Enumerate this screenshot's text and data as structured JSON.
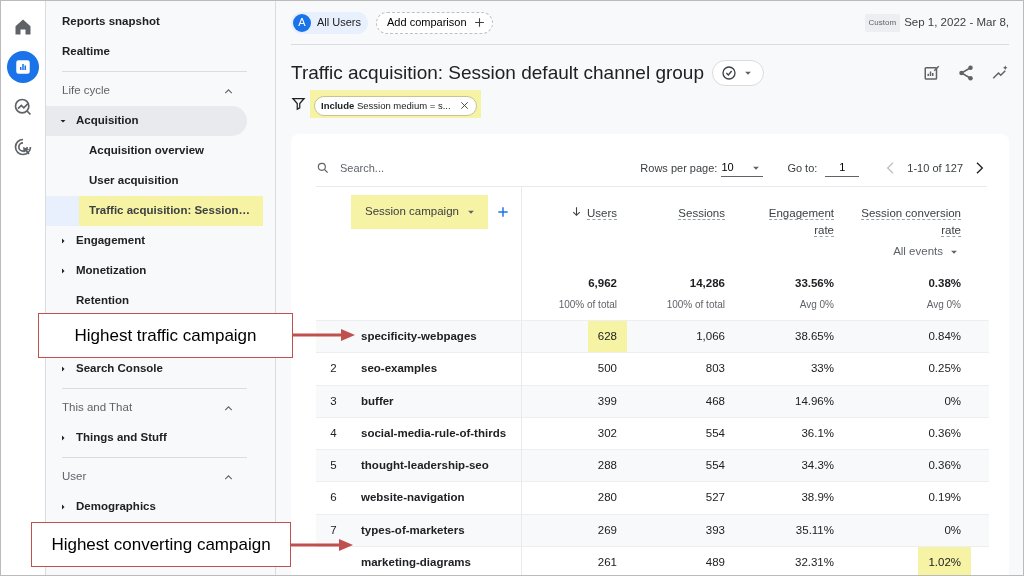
{
  "rail": [
    {
      "selected": false
    },
    {
      "selected": true
    },
    {
      "selected": false
    },
    {
      "selected": false
    }
  ],
  "sidebar": {
    "links": [
      {
        "label": "Reports snapshot"
      },
      {
        "label": "Realtime"
      }
    ],
    "sections": [
      {
        "title": "Life cycle",
        "expanded": true,
        "items": [
          {
            "label": "Acquisition",
            "expanded": true,
            "children": [
              {
                "label": "Acquisition overview",
                "selected": false,
                "highlighted": false
              },
              {
                "label": "User acquisition",
                "selected": false,
                "highlighted": false
              },
              {
                "label": "Traffic acquisition: Session…",
                "selected": true,
                "highlighted": true
              }
            ]
          },
          {
            "label": "Engagement",
            "expanded": false
          },
          {
            "label": "Monetization",
            "expanded": false
          },
          {
            "label": "Retention"
          },
          {
            "label": "Search Console",
            "expanded": false
          }
        ]
      },
      {
        "title": "This and That",
        "expanded": true,
        "items": [
          {
            "label": "Things and Stuff",
            "expanded": false
          }
        ]
      },
      {
        "title": "User",
        "expanded": true,
        "items": [
          {
            "label": "Demographics",
            "expanded": false
          }
        ]
      }
    ]
  },
  "topbar": {
    "segment": {
      "avatar": "A",
      "label": "All Users"
    },
    "add_comparison": "Add comparison",
    "date_badge": "Custom",
    "date_range": "Sep 1, 2022 - Mar 8,"
  },
  "report": {
    "title": "Traffic acquisition: Session default channel group",
    "filter": {
      "text": "**Include** Session medium = s...",
      "highlighted": true
    }
  },
  "table": {
    "search": {
      "placeholder": "Search..."
    },
    "rows_per_page_label": "Rows per page:",
    "rows_per_page": "10",
    "goto_label": "Go to:",
    "goto": "1",
    "range": "1-10 of 127",
    "dimension": {
      "label": "Session campaign",
      "highlighted": true
    },
    "columns": [
      {
        "label": "Users",
        "sorted": true
      },
      {
        "label": "Sessions",
        "sorted": false
      },
      {
        "label": "Engagement rate",
        "sorted": false
      },
      {
        "label": "Session conversion rate",
        "sorted": false,
        "dropdown": "All events"
      }
    ],
    "totals": [
      {
        "value": "6,962",
        "note": "100% of total"
      },
      {
        "value": "14,286",
        "note": "100% of total"
      },
      {
        "value": "33.56%",
        "note": "Avg 0%"
      },
      {
        "value": "0.38%",
        "note": "Avg 0%"
      }
    ],
    "rows": [
      {
        "campaign": "specificity-webpages",
        "cells": [
          {
            "text": "628",
            "highlighted": true
          },
          {
            "text": "1,066",
            "highlighted": false
          },
          {
            "text": "38.65%",
            "highlighted": false
          },
          {
            "text": "0.84%",
            "highlighted": false
          }
        ]
      },
      {
        "rank": "2",
        "campaign": "seo-examples",
        "cells": [
          {
            "text": "500",
            "highlighted": false
          },
          {
            "text": "803",
            "highlighted": false
          },
          {
            "text": "33%",
            "highlighted": false
          },
          {
            "text": "0.25%",
            "highlighted": false
          }
        ]
      },
      {
        "rank": "3",
        "campaign": "buffer",
        "cells": [
          {
            "text": "399",
            "highlighted": false
          },
          {
            "text": "468",
            "highlighted": false
          },
          {
            "text": "14.96%",
            "highlighted": false
          },
          {
            "text": "0%",
            "highlighted": false
          }
        ]
      },
      {
        "rank": "4",
        "campaign": "social-media-rule-of-thirds",
        "cells": [
          {
            "text": "302",
            "highlighted": false
          },
          {
            "text": "554",
            "highlighted": false
          },
          {
            "text": "36.1%",
            "highlighted": false
          },
          {
            "text": "0.36%",
            "highlighted": false
          }
        ]
      },
      {
        "rank": "5",
        "campaign": "thought-leadership-seo",
        "cells": [
          {
            "text": "288",
            "highlighted": false
          },
          {
            "text": "554",
            "highlighted": false
          },
          {
            "text": "34.3%",
            "highlighted": false
          },
          {
            "text": "0.36%",
            "highlighted": false
          }
        ]
      },
      {
        "rank": "6",
        "campaign": "website-navigation",
        "cells": [
          {
            "text": "280",
            "highlighted": false
          },
          {
            "text": "527",
            "highlighted": false
          },
          {
            "text": "38.9%",
            "highlighted": false
          },
          {
            "text": "0.19%",
            "highlighted": false
          }
        ]
      },
      {
        "rank": "7",
        "campaign": "types-of-marketers",
        "cells": [
          {
            "text": "269",
            "highlighted": false
          },
          {
            "text": "393",
            "highlighted": false
          },
          {
            "text": "35.11%",
            "highlighted": false
          },
          {
            "text": "0%",
            "highlighted": false
          }
        ]
      },
      {
        "campaign": "marketing-diagrams",
        "cells": [
          {
            "text": "261",
            "highlighted": false
          },
          {
            "text": "489",
            "highlighted": false
          },
          {
            "text": "32.31%",
            "highlighted": false
          },
          {
            "text": "1.02%",
            "highlighted": true
          }
        ]
      }
    ]
  },
  "callouts": [
    {
      "text": "Highest traffic campaign"
    },
    {
      "text": "Highest converting campaign"
    }
  ]
}
